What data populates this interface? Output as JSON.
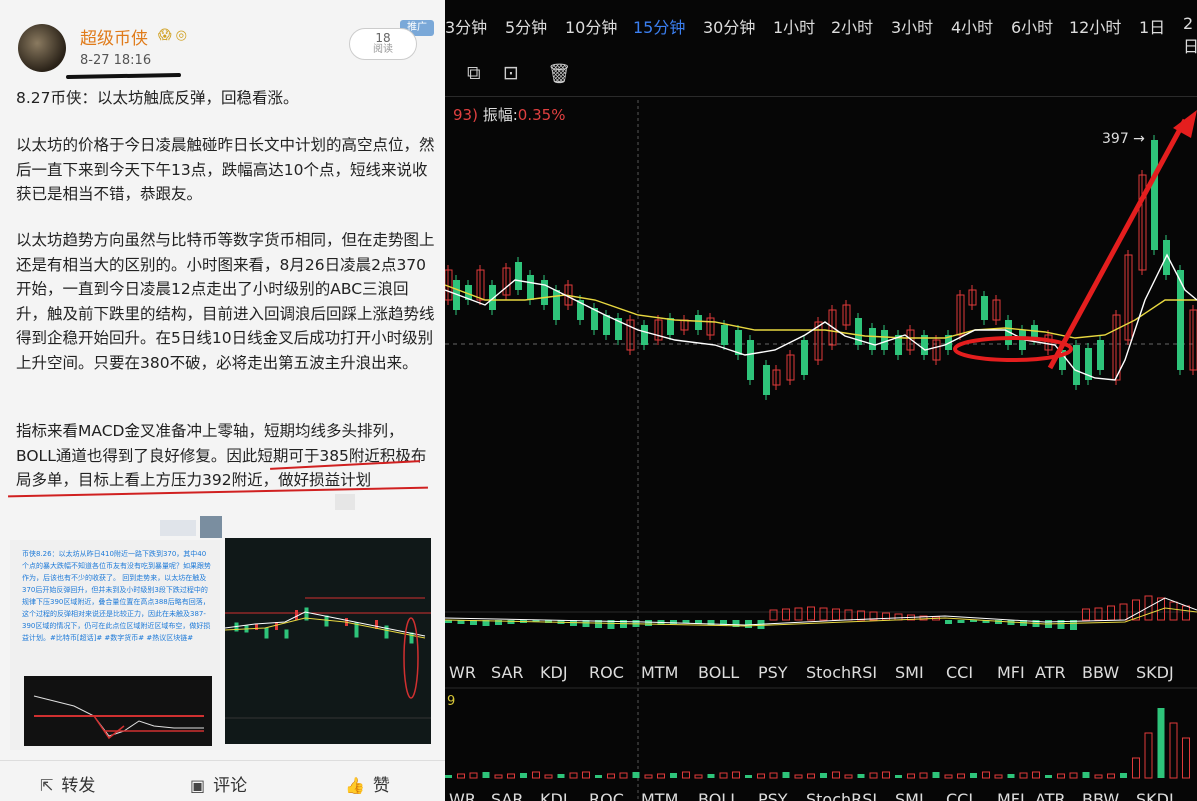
{
  "post": {
    "username": "超级币侠",
    "badges": "😱 ◎",
    "time": "8-27 18:16",
    "reads_count": "18",
    "reads_label": "阅读",
    "recommend_tag": "推广",
    "para1": "8.27币侠：以太坊触底反弹，回稳看涨。",
    "para2": "以太坊的价格于今日凌晨触碰昨日长文中计划的高空点位，然后一直下来到今天下午13点，跌幅高达10个点，短线来说收获已是相当不错，恭跟友。",
    "para3": "以太坊趋势方向虽然与比特币等数字货币相同，但在走势图上还是有相当大的区别的。小时图来看，8月26日凌晨2点370开始，一直到今日凌晨12点走出了小时级别的ABC三浪回升，触及前下跌里的结构，目前进入回调浪后回踩上涨趋势线得到企稳开始回升。在5日线10日线金叉后成功打开小时级别上升空间。只要在380不破，必将走出第五波主升浪出来。",
    "para4": "指标来看MACD金叉准备冲上零轴，短期均线多头排列，BOLL通道也得到了良好修复。因此短期可于385附近积极布局多单，目标上看上方压力392附近，做好损益计划",
    "thumb_text": "币侠8.26：以太坊从昨日410附近一路下跌到370，其中40个点的暴大跌幅不知道各位币友有没有吃到暴量呢？如果跟势作为，后该也有不少的收获了。 回到走势来，以太坊在触及370后开始反弹回升，但并未到及小时级别3段下跌过程中的规律下压390区域附近，叠合量位置在高点388后略有回落，这个过程的反弹相对来说还是比较正力，因此在未触及387-390区域的情况下，仍可在此点位区域附近区域布空，做好损益计划。#比特币[超话]# #数字货币# #热议区块链#"
  },
  "actions": {
    "forward": "转发",
    "comment": "评论",
    "like": "赞"
  },
  "chart": {
    "timeframes": [
      "3分钟",
      "5分钟",
      "10分钟",
      "15分钟",
      "30分钟",
      "1小时",
      "2小时",
      "3小时",
      "4小时",
      "6小时",
      "12小时",
      "1日",
      "2日"
    ],
    "active_timeframe": "15分钟",
    "amp_prefix": "93)",
    "amp_label": "振幅:",
    "amp_value": "0.35%",
    "price_label": "397 →",
    "sub_label": "9",
    "indicators": [
      "WR",
      "SAR",
      "KDJ",
      "ROC",
      "MTM",
      "BOLL",
      "PSY",
      "StochRSI",
      "SMI",
      "CCI",
      "MFI",
      "ATR",
      "BBW",
      "SKDJ"
    ],
    "colors": {
      "up": "#e03a3a",
      "down": "#2ec47a",
      "ma_white": "#ffffff",
      "ma_yellow": "#e8d840",
      "accent": "#3b7ff0"
    }
  }
}
